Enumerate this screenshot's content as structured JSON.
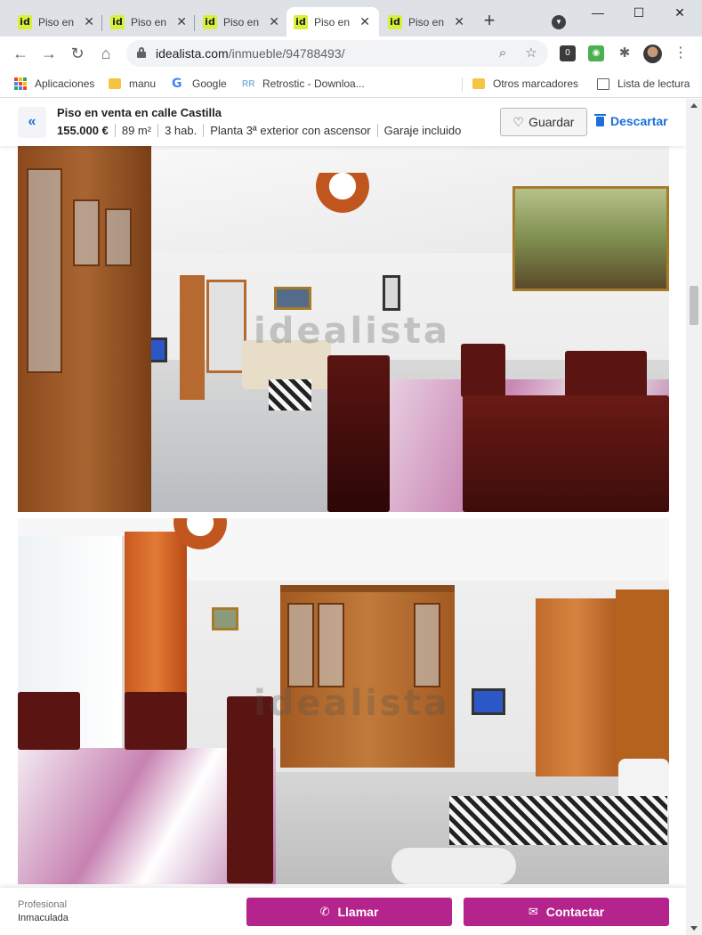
{
  "browser": {
    "tabs": [
      {
        "label": "Piso en",
        "favicon": "id",
        "active": false
      },
      {
        "label": "Piso en",
        "favicon": "id",
        "active": false
      },
      {
        "label": "Piso en",
        "favicon": "id",
        "active": false
      },
      {
        "label": "Piso en",
        "favicon": "id",
        "active": true
      },
      {
        "label": "Piso en",
        "favicon": "id",
        "active": false
      }
    ],
    "new_tab_label": "+",
    "url_host": "idealista.com",
    "url_path": "/inmueble/94788493/",
    "bookmarks": [
      {
        "label": "Aplicaciones",
        "icon": "apps-grid-icon"
      },
      {
        "label": "manu",
        "icon": "folder-icon"
      },
      {
        "label": "Google",
        "icon": "google-icon"
      },
      {
        "label": "Retrostic - Downloa...",
        "icon": "retrostic-icon"
      },
      {
        "label": "Otros marcadores",
        "icon": "folder-icon"
      },
      {
        "label": "Lista de lectura",
        "icon": "reading-list-icon"
      }
    ]
  },
  "listing": {
    "title": "Piso en venta en calle Castilla",
    "price": "155.000 €",
    "area": "89 m²",
    "rooms": "3 hab.",
    "floor": "Planta 3ª exterior con ascensor",
    "garage": "Garaje incluido",
    "save_label": "Guardar",
    "discard_label": "Descartar"
  },
  "gallery": {
    "watermark": "idealista"
  },
  "contact": {
    "agent_type": "Profesional",
    "agent_name": "Inmaculada",
    "call_label": "Llamar",
    "contact_label": "Contactar"
  },
  "colors": {
    "brand_accent": "#b5238c",
    "link_blue": "#1a6fdb",
    "favicon_yellow": "#d8f03c"
  }
}
